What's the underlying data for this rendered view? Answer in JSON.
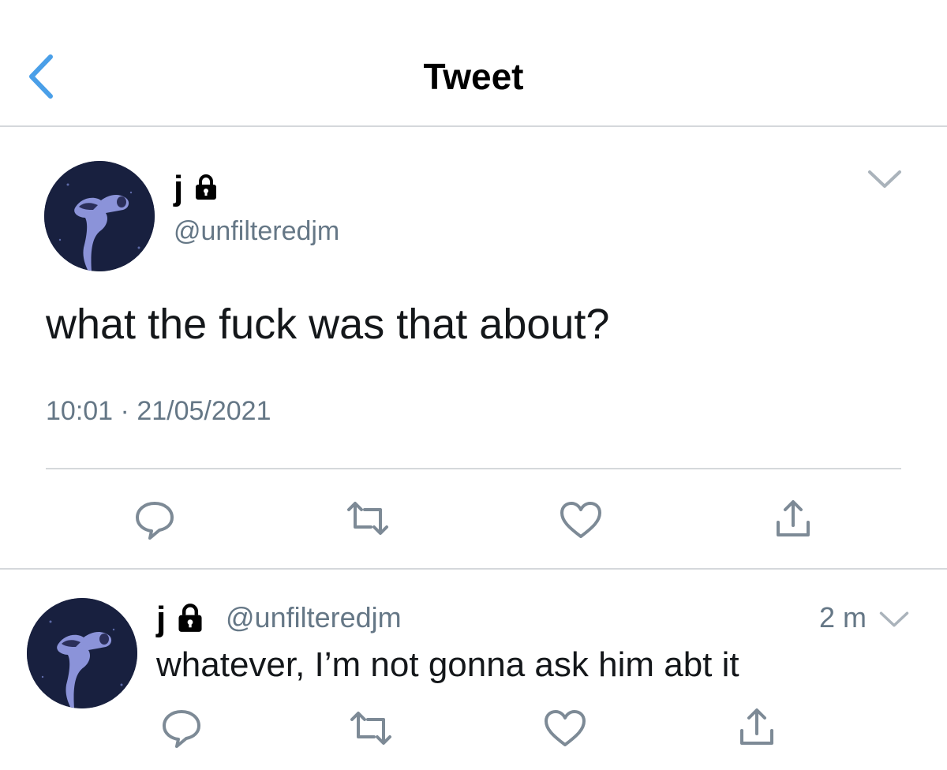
{
  "header": {
    "title": "Tweet",
    "back_icon": "chevron-left-icon"
  },
  "main_tweet": {
    "display_name": "j",
    "handle": "@unfilteredjm",
    "text": "what the fuck was that about?",
    "time": "10:01",
    "separator": "·",
    "date": "21/05/2021",
    "icons": [
      "lock-icon",
      "chevron-down-icon",
      "reply-icon",
      "retweet-icon",
      "like-icon",
      "share-icon"
    ]
  },
  "reply_tweet": {
    "display_name": "j",
    "handle": "@unfilteredjm",
    "time_ago": "2 m",
    "text": "whatever, I’m not gonna ask him abt it",
    "icons": [
      "lock-icon",
      "chevron-down-icon",
      "reply-icon",
      "retweet-icon",
      "like-icon",
      "share-icon"
    ]
  },
  "colors": {
    "accent": "#4a9fe8",
    "secondary_text": "#657786",
    "icon_gray": "#7d8a96",
    "divider": "#d5d8db"
  }
}
